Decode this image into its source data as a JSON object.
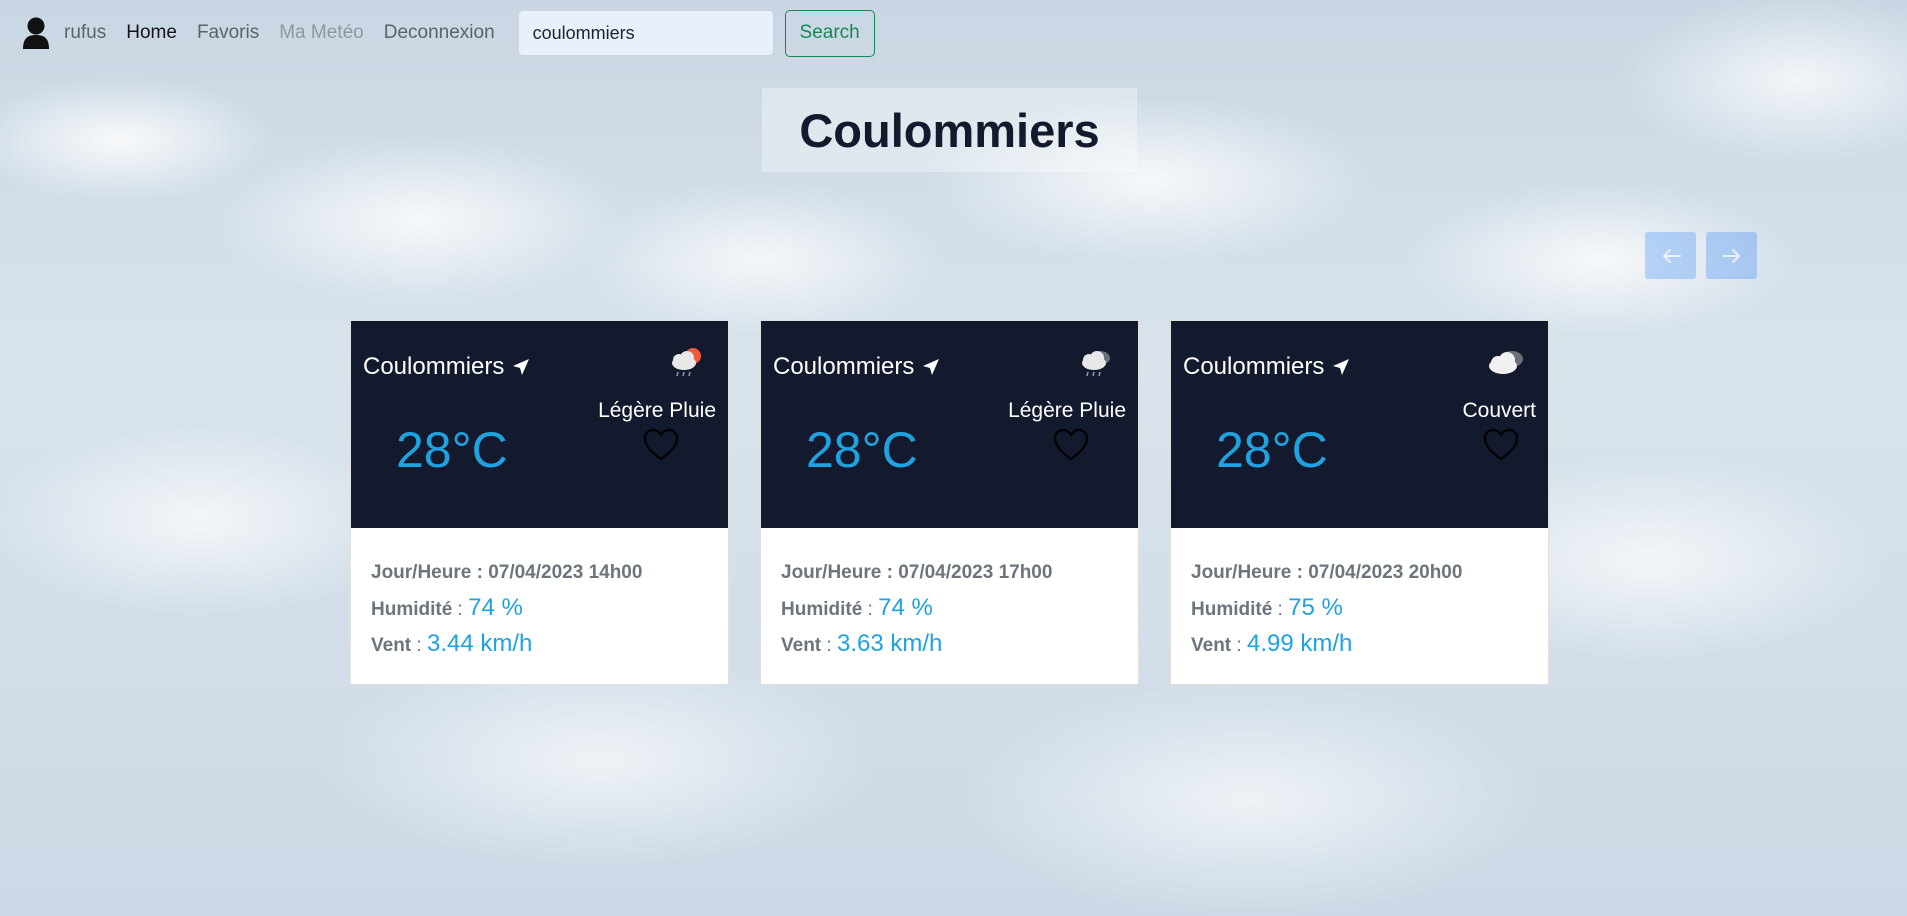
{
  "nav": {
    "user": "rufus",
    "home": "Home",
    "favoris": "Favoris",
    "ma_meteo": "Ma Metéo",
    "deconnexion": "Deconnexion",
    "search_value": "coulommiers",
    "search_button": "Search"
  },
  "page_title": "Coulommiers",
  "forecasts": [
    {
      "city": "Coulommiers",
      "description": "Légère Pluie",
      "icon": "rain-sun-icon",
      "temperature": "28°C",
      "date_label": "Jour/Heure : 07/04/2023 14h00",
      "humidity_label": "Humidité",
      "humidity_value": "74 %",
      "wind_label": "Vent",
      "wind_value": "3.44 km/h"
    },
    {
      "city": "Coulommiers",
      "description": "Légère Pluie",
      "icon": "rain-cloud-icon",
      "temperature": "28°C",
      "date_label": "Jour/Heure : 07/04/2023 17h00",
      "humidity_label": "Humidité",
      "humidity_value": "74 %",
      "wind_label": "Vent",
      "wind_value": "3.63 km/h"
    },
    {
      "city": "Coulommiers",
      "description": "Couvert",
      "icon": "overcast-icon",
      "temperature": "28°C",
      "date_label": "Jour/Heure : 07/04/2023 20h00",
      "humidity_label": "Humidité",
      "humidity_value": "75 %",
      "wind_label": "Vent",
      "wind_value": "4.99 km/h"
    }
  ],
  "colors": {
    "card_header": "#141a2e",
    "accent": "#1fa2e0",
    "search_button": "#198754"
  }
}
